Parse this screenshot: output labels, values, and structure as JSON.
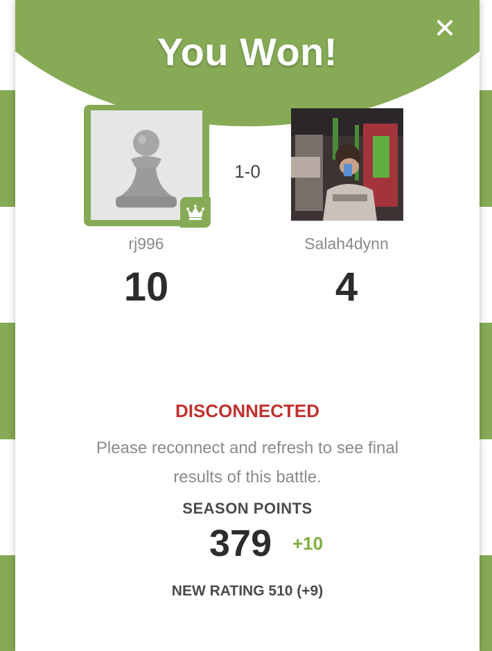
{
  "colors": {
    "accent": "#86aa55",
    "disconnected": "#c0312d",
    "delta_positive": "#7fb03f"
  },
  "modal": {
    "title": "You Won!",
    "close_icon": "close-icon"
  },
  "match": {
    "score": "1-0",
    "winner": {
      "username": "rj996",
      "points": "10",
      "avatar_icon": "pawn-icon",
      "badge_icon": "crown-icon"
    },
    "opponent": {
      "username": "Salah4dynn",
      "points": "4",
      "avatar": "user-photo"
    }
  },
  "status": {
    "label": "DISCONNECTED",
    "message": "Please reconnect and refresh to see final results of this battle."
  },
  "season": {
    "label": "SEASON POINTS",
    "value": "379",
    "delta": "+10"
  },
  "rating": {
    "text": "NEW RATING 510 (+9)"
  }
}
